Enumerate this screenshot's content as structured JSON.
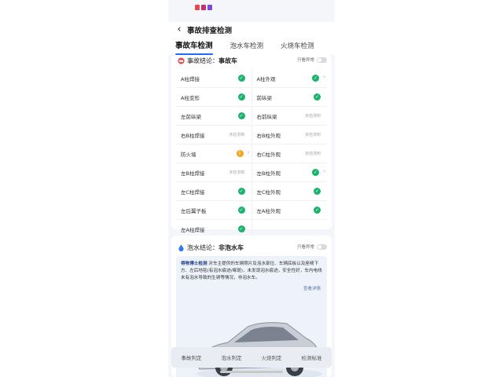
{
  "status_icons": [
    {
      "name": "app-icon-red",
      "color": "#e5484d"
    },
    {
      "name": "app-icon-magenta",
      "color": "#c4306a"
    },
    {
      "name": "app-icon-purple",
      "color": "#7b4ad6"
    }
  ],
  "header": {
    "title": "事故排查检测"
  },
  "tabs": [
    {
      "label": "事故车检测",
      "active": true
    },
    {
      "label": "泡水车检测",
      "active": false
    },
    {
      "label": "火烧车检测",
      "active": false
    }
  ],
  "accident": {
    "label": "事故结论：",
    "value": "事故车",
    "toggle_label": "只看异常",
    "rows": [
      [
        {
          "label": "A柱焊接",
          "status": "ok"
        },
        {
          "label": "A柱外观",
          "status": "ok",
          "chevron": true
        }
      ],
      [
        {
          "label": "A柱变形",
          "status": "ok"
        },
        {
          "label": "前纵梁",
          "status": "ok"
        }
      ],
      [
        {
          "label": "左前纵梁",
          "status": "ok"
        },
        {
          "label": "右前纵梁",
          "note": "未检测到"
        }
      ],
      [
        {
          "label": "右B柱焊接",
          "note": "未检测到"
        },
        {
          "label": "右B柱外观",
          "note": "未检测到"
        }
      ],
      [
        {
          "label": "防火墙",
          "status": "warn",
          "chevron": true
        },
        {
          "label": "右C柱外观",
          "note": "未检测到"
        }
      ],
      [
        {
          "label": "左B柱焊接",
          "note": "未检测到"
        },
        {
          "label": "左B柱外观",
          "status": "ok",
          "chevron": true
        }
      ],
      [
        {
          "label": "左C柱焊接",
          "status": "ok"
        },
        {
          "label": "左C柱外观",
          "status": "ok"
        }
      ],
      [
        {
          "label": "左后翼子板",
          "status": "ok"
        },
        {
          "label": "左A柱外观",
          "status": "ok"
        }
      ],
      [
        {
          "label": "左A柱焊接",
          "status": "ok"
        },
        {
          "label": ""
        }
      ]
    ]
  },
  "flood": {
    "label": "泡水结论：",
    "value": "非泡水车",
    "toggle_label": "只看异常",
    "text_brand": "得物博士检测",
    "text_body": "对车主提供的车辆照片及泡水部位、车辆底板以及座椅下方、左后地毯(有泡水痕迹/霉斑)，未发现泡水痕迹，安全性好，车内电线未有泡水导致的生锈等情况，非泡水车。",
    "detail_link": "查看详情"
  },
  "bottom_bar": [
    "事故判定",
    "泡水判定",
    "火烧判定",
    "检测标准"
  ],
  "colors": {
    "accent": "#1f6bff",
    "ok": "#18b46b",
    "warn": "#f7a21b"
  }
}
